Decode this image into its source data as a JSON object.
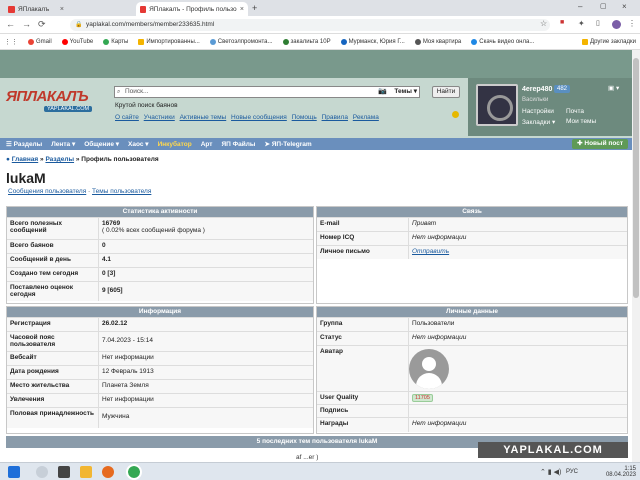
{
  "browser": {
    "tabs": [
      {
        "title": "ЯПлакалъ",
        "active": false
      },
      {
        "title": "ЯПлакалъ - Профиль пользовате",
        "active": true
      }
    ],
    "new_tab": "+",
    "url": "yaplakal.com/members/member233635.html",
    "bookmarks": [
      {
        "label": "Gmail",
        "color": "#ea4335"
      },
      {
        "label": "YouTube",
        "color": "#ff0000"
      },
      {
        "label": "Карты",
        "color": "#34a853"
      },
      {
        "label": "Импортированны...",
        "color": "#f4b400"
      },
      {
        "label": "Светоэлпромонта...",
        "color": "#5b9bd5"
      },
      {
        "label": "закалиьта 10Р",
        "color": "#2e7d32"
      },
      {
        "label": "Мурманск, Юрия Г...",
        "color": "#1565c0"
      },
      {
        "label": "Моя квартира",
        "color": "#555555"
      },
      {
        "label": "Скачь видео онла...",
        "color": "#1e88e5"
      }
    ],
    "other_bookmarks": "Другие закладки"
  },
  "site": {
    "logo_main": "ЯПЛАКАЛЪ",
    "logo_sub": "YAPLAKAL.COM",
    "search_placeholder": "Поиск...",
    "search_scope": "Темы",
    "find_button": "Найти",
    "tagline": "Крутой поиск баянов",
    "header_links": [
      "О сайте",
      "Участники",
      "Активные темы",
      "Новые сообщения",
      "Помощь",
      "Правила",
      "Реклама"
    ],
    "user": {
      "name": "4erep480",
      "count": "482",
      "status": "Васильки",
      "settings": "Настройки",
      "mail": "Почта",
      "bookmarks": "Закладки",
      "my_themes": "Мои темы"
    },
    "nav": [
      "Разделы",
      "Лента",
      "Общение",
      "Хаос",
      "Инкубатор",
      "Арт",
      "ЯП Файлы",
      "ЯП-Telegram"
    ],
    "new_post": "Новый пост"
  },
  "breadcrumb": {
    "home": "Главная",
    "sections": "Разделы",
    "current": "Профиль пользователя",
    "sep": "»"
  },
  "profile": {
    "name": "lukaM",
    "link_messages": "Сообщения пользователя",
    "link_sep": " · ",
    "link_themes": "Темы пользователя"
  },
  "stats": {
    "title": "Статистика активности",
    "rows": [
      {
        "label": "Всего полезных сообщений",
        "value": "16769",
        "sub": "( 0.02% всех сообщений форума )"
      },
      {
        "label": "Всего баянов",
        "value": "0"
      },
      {
        "label": "Сообщений в день",
        "value": "4.1"
      },
      {
        "label": "Создано тем сегодня",
        "value": "0 [3]"
      },
      {
        "label": "Поставлено оценок сегодня",
        "value": "9 [605]"
      }
    ]
  },
  "contact": {
    "title": "Связь",
    "rows": [
      {
        "label": "E-mail",
        "value": "Приват"
      },
      {
        "label": "Номер ICQ",
        "value": "Нет информации"
      },
      {
        "label": "Личное письмо",
        "value": "Отправить"
      }
    ]
  },
  "info": {
    "title": "Информация",
    "rows": [
      {
        "label": "Регистрация",
        "value": "26.02.12"
      },
      {
        "label": "Часовой пояс пользователя",
        "value": "7.04.2023 - 15:14"
      },
      {
        "label": "Вебсайт",
        "value": "Нет информации"
      },
      {
        "label": "Дата рождения",
        "value": "12 Февраль 1913"
      },
      {
        "label": "Место жительства",
        "value": "Планета Земля"
      },
      {
        "label": "Увлечения",
        "value": "Нет информации"
      },
      {
        "label": "Половая принадлежность",
        "value": "Мужчина"
      }
    ]
  },
  "personal": {
    "title": "Личные данные",
    "rows": [
      {
        "label": "Группа",
        "value": "Пользователи"
      },
      {
        "label": "Статус",
        "value": "Нет информации"
      },
      {
        "label": "Аватар",
        "value": ""
      },
      {
        "label": "User Quality",
        "value": "11705"
      },
      {
        "label": "Подпись",
        "value": ""
      },
      {
        "label": "Награды",
        "value": "Нет информации"
      }
    ]
  },
  "last_themes_title": "5 последних тем пользователя lukaM",
  "last_themes_partial": "af ...er )",
  "watermark": "YAPLAKAL.COM",
  "taskbar": {
    "lang": "РУС",
    "time": "1:15",
    "date": "08.04.2023"
  },
  "colors": {
    "nav": "#6a8fbd",
    "header": "#c6d8d0",
    "topstrip": "#79998c",
    "panel_head": "#8a9baa",
    "new_post": "#5f9a57"
  }
}
